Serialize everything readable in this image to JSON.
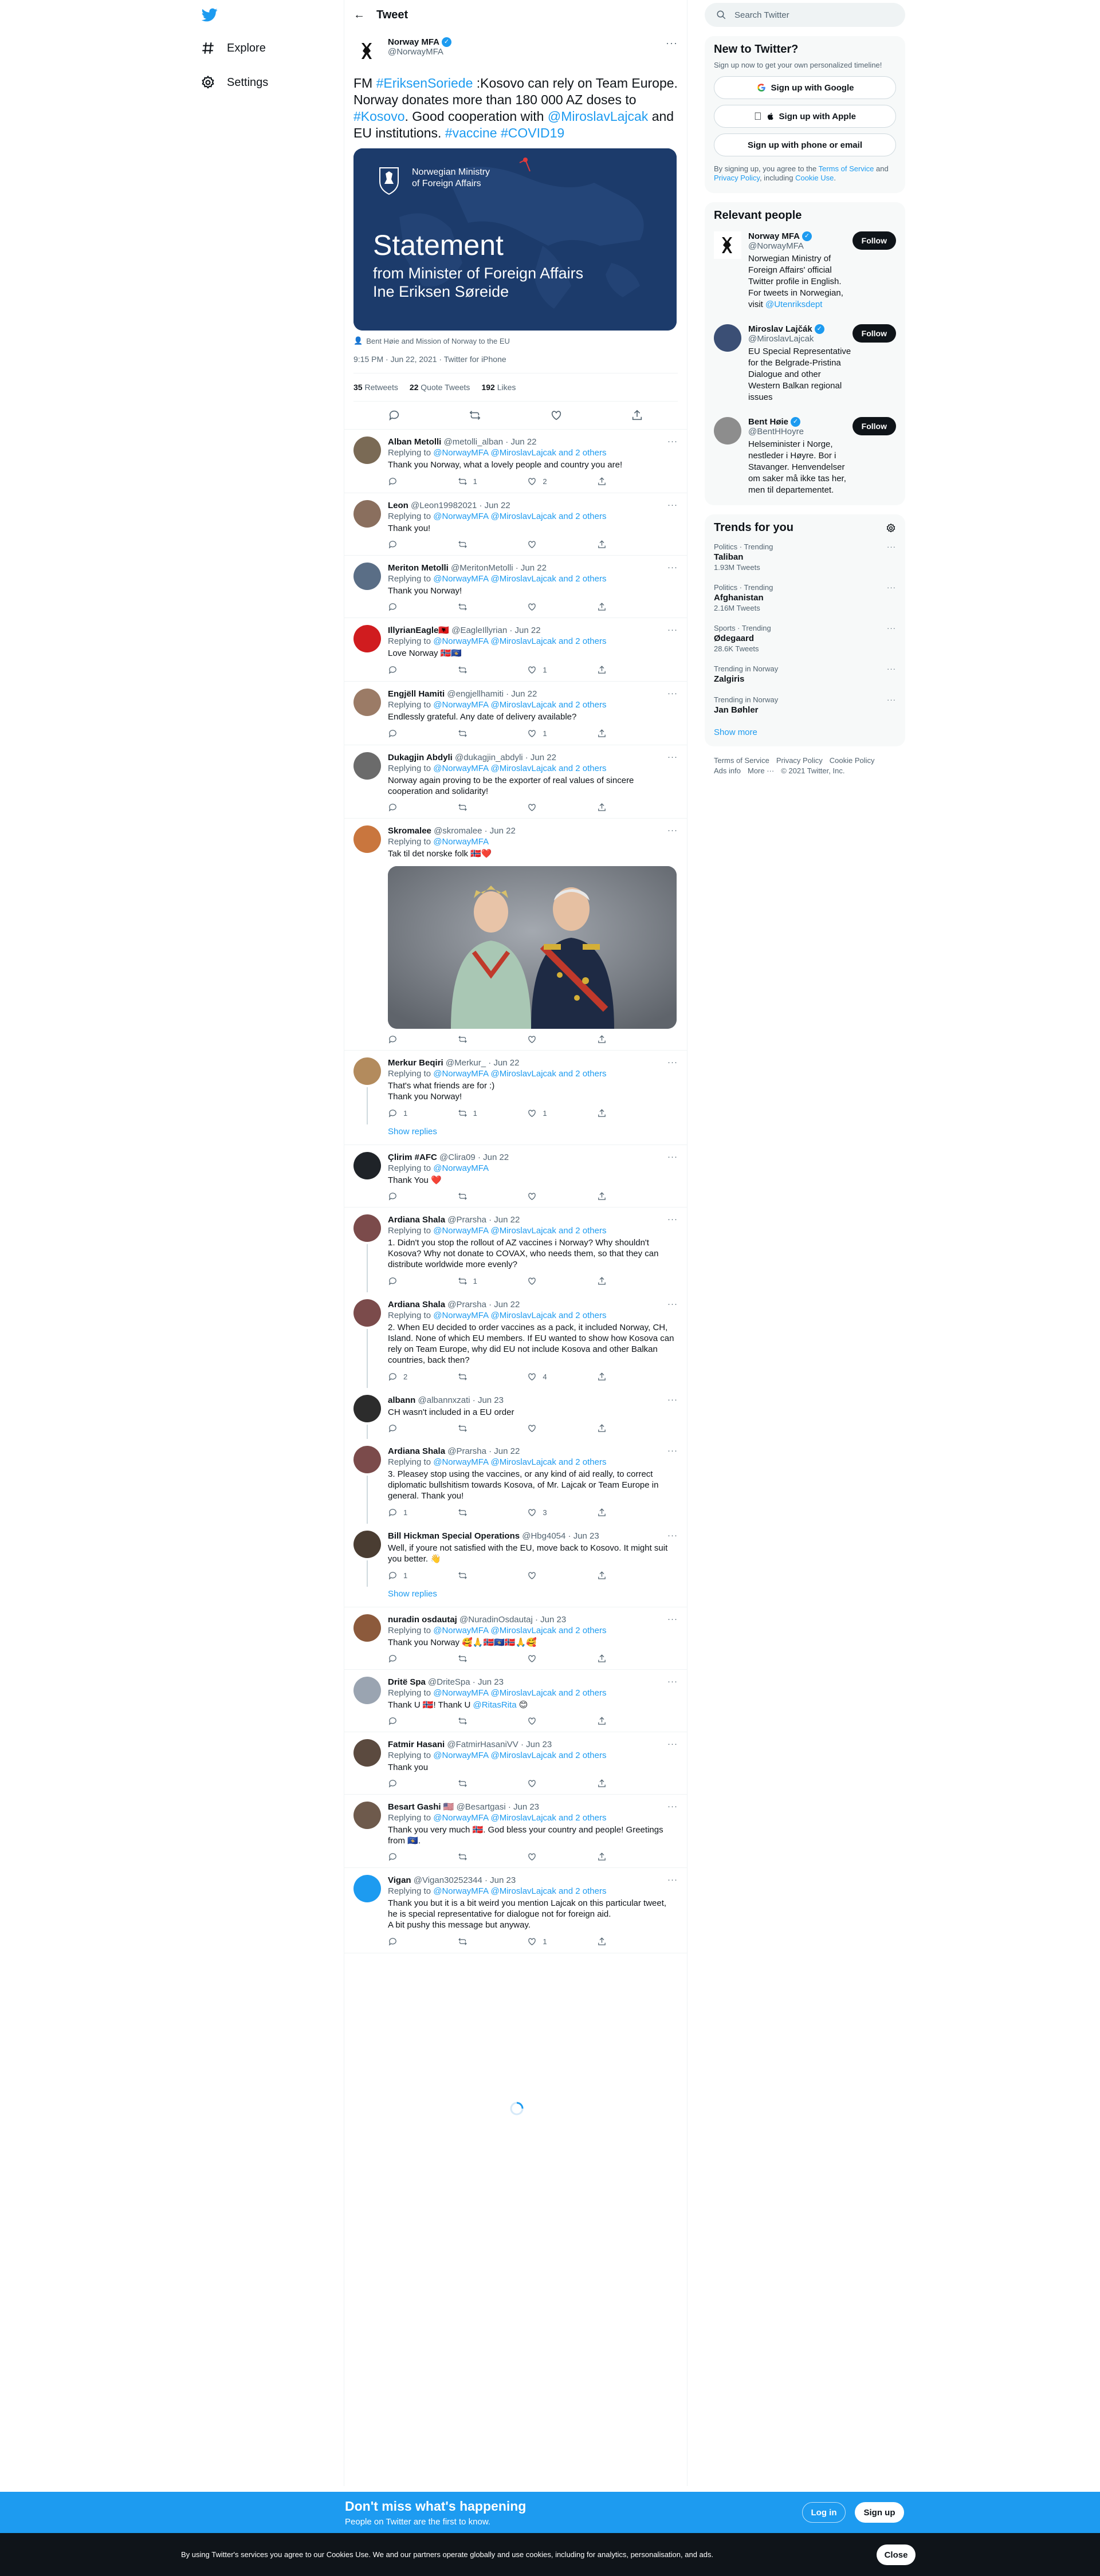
{
  "nav": {
    "explore": "Explore",
    "settings": "Settings"
  },
  "header": {
    "title": "Tweet"
  },
  "tweet": {
    "author": "Norway MFA",
    "handle": "@NorwayMFA",
    "text_parts": [
      {
        "t": "FM ",
        "link": false
      },
      {
        "t": "#EriksenSoriede",
        "link": true
      },
      {
        "t": " :Kosovo can rely on Team Europe. Norway donates more than 180 000 AZ doses to ",
        "link": false
      },
      {
        "t": "#Kosovo",
        "link": true
      },
      {
        "t": ". Good cooperation with ",
        "link": false
      },
      {
        "t": "@MiroslavLajcak",
        "link": true
      },
      {
        "t": " and EU institutions. ",
        "link": false
      },
      {
        "t": "#vaccine",
        "link": true
      },
      {
        "t": " ",
        "link": false
      },
      {
        "t": "#COVID19",
        "link": true
      }
    ],
    "card": {
      "ministry_line1": "Norwegian Ministry",
      "ministry_line2": "of Foreign Affairs",
      "statement": "Statement",
      "sub_line1": "from Minister of Foreign Affairs",
      "sub_line2": "Ine Eriksen Søreide"
    },
    "tagged": "Bent Høie and Mission of Norway to the EU",
    "meta": "9:15 PM · Jun 22, 2021 · Twitter for iPhone",
    "retweets": "35",
    "retweets_label": "Retweets",
    "quotes": "22",
    "quotes_label": "Quote Tweets",
    "likes": "192",
    "likes_label": "Likes"
  },
  "replies": [
    {
      "name": "Alban Metolli",
      "handle": "@metolli_alban · Jun 22",
      "replying": "@NorwayMFA @MiroslavLajcak and 2 others",
      "text": "Thank you Norway, what a lovely people and country you are!",
      "reply_count": "",
      "rt_count": "1",
      "like_count": "2",
      "avatar_color": "#7a6a55"
    },
    {
      "name": "Leon",
      "handle": "@Leon19982021 · Jun 22",
      "replying": "@NorwayMFA @MiroslavLajcak and 2 others",
      "text": "Thank you!",
      "reply_count": "",
      "rt_count": "",
      "like_count": "",
      "avatar_color": "#8a6f5e"
    },
    {
      "name": "Meriton Metolli",
      "handle": "@MeritonMetolli · Jun 22",
      "replying": "@NorwayMFA @MiroslavLajcak and 2 others",
      "text": "Thank you Norway!",
      "reply_count": "",
      "rt_count": "",
      "like_count": "",
      "avatar_color": "#5a6e86"
    },
    {
      "name": "IllyrianEagle🇦🇱",
      "handle": "@EagleIllyrian · Jun 22",
      "replying": "@NorwayMFA @MiroslavLajcak and 2 others",
      "text": "Love Norway 🇳🇴🇽🇰",
      "reply_count": "",
      "rt_count": "",
      "like_count": "1",
      "avatar_color": "#d01c1f"
    },
    {
      "name": "Engjëll Hamiti",
      "handle": "@engjellhamiti · Jun 22",
      "replying": "@NorwayMFA @MiroslavLajcak and 2 others",
      "text": "Endlessly grateful. Any date of delivery available?",
      "reply_count": "",
      "rt_count": "",
      "like_count": "1",
      "avatar_color": "#9b7b66"
    },
    {
      "name": "Dukagjin Abdyli",
      "handle": "@dukagjin_abdyli · Jun 22",
      "replying": "@NorwayMFA @MiroslavLajcak and 2 others",
      "text": "Norway again proving to be the exporter of real values of sincere cooperation and solidarity!",
      "reply_count": "",
      "rt_count": "",
      "like_count": "",
      "avatar_color": "#6b6b6b"
    },
    {
      "name": "Skromalee",
      "handle": "@skromalee · Jun 22",
      "replying": "@NorwayMFA",
      "text": "Tak til det norske folk 🇳🇴❤️",
      "reply_count": "",
      "rt_count": "",
      "like_count": "",
      "avatar_color": "#c9763e"
    },
    {
      "name": "Merkur Beqiri",
      "handle": "@Merkur_ · Jun 22",
      "replying": "@NorwayMFA @MiroslavLajcak and 2 others",
      "text": "That's what friends are for :)",
      "text2": "Thank you Norway!",
      "reply_count": "1",
      "rt_count": "1",
      "like_count": "1",
      "avatar_color": "#b38b5d"
    },
    {
      "name": "Çlirim #AFC",
      "handle": "@Clira09 · Jun 22",
      "replying": "@NorwayMFA",
      "text": "Thank You ❤️",
      "reply_count": "",
      "rt_count": "",
      "like_count": "",
      "avatar_color": "#1f2328"
    },
    {
      "name": "Ardiana Shala",
      "handle": "@Prarsha · Jun 22",
      "replying": "@NorwayMFA @MiroslavLajcak and 2 others",
      "text": "1. Didn't you stop the rollout of AZ vaccines i Norway? Why shouldn't Kosova? Why not donate to COVAX, who needs them, so that they can distribute worldwide more evenly?",
      "reply_count": "",
      "rt_count": "1",
      "like_count": "",
      "avatar_color": "#7b4b4b"
    },
    {
      "name": "Ardiana Shala",
      "handle": "@Prarsha · Jun 22",
      "replying": "@NorwayMFA @MiroslavLajcak and 2 others",
      "text": "2. When EU decided to order vaccines as a pack, it included Norway, CH, Island. None of which EU members. If EU wanted to show how Kosova can rely on Team Europe, why did EU not include Kosova and other Balkan countries, back then?",
      "reply_count": "2",
      "rt_count": "",
      "like_count": "4",
      "avatar_color": "#7b4b4b"
    },
    {
      "name": "albann",
      "handle": "@albannxzati · Jun 23",
      "replying": "",
      "text": "CH wasn't included in a EU order",
      "reply_count": "",
      "rt_count": "",
      "like_count": "",
      "avatar_color": "#2c2c2c"
    },
    {
      "name": "Ardiana Shala",
      "handle": "@Prarsha · Jun 22",
      "replying": "@NorwayMFA @MiroslavLajcak and 2 others",
      "text": "3. Pleasey stop using the vaccines, or any kind of aid really, to correct diplomatic bullshitism towards Kosova, of Mr. Lajcak or Team Europe in general. Thank you!",
      "reply_count": "1",
      "rt_count": "",
      "like_count": "3",
      "avatar_color": "#7b4b4b"
    },
    {
      "name": "Bill Hickman Special Operations",
      "handle": "@Hbg4054 · Jun 23",
      "replying": "",
      "text": "Well, if youre not satisfied with the EU, move back to Kosovo. It might suit you better. 👋",
      "reply_count": "1",
      "rt_count": "",
      "like_count": "",
      "avatar_color": "#4a3d32"
    },
    {
      "name": "nuradin osdautaj",
      "handle": "@NuradinOsdautaj · Jun 23",
      "replying": "@NorwayMFA @MiroslavLajcak and 2 others",
      "text": "Thank you Norway 🥰🙏🇳🇴🇽🇰🇳🇴🙏🥰",
      "reply_count": "",
      "rt_count": "",
      "like_count": "",
      "avatar_color": "#8c5a3c"
    },
    {
      "name": "Dritë Spa",
      "handle": "@DriteSpa · Jun 23",
      "replying": "@NorwayMFA @MiroslavLajcak and 2 others",
      "text_parts": [
        {
          "t": "Thank U 🇳🇴! Thank U ",
          "link": false
        },
        {
          "t": "@RitasRita",
          "link": true
        },
        {
          "t": " 😊",
          "link": false
        }
      ],
      "reply_count": "",
      "rt_count": "",
      "like_count": "",
      "avatar_color": "#9aa4b1"
    },
    {
      "name": "Fatmir Hasani",
      "handle": "@FatmirHasaniVV · Jun 23",
      "replying": "@NorwayMFA @MiroslavLajcak and 2 others",
      "text": "Thank you",
      "reply_count": "",
      "rt_count": "",
      "like_count": "",
      "avatar_color": "#5b4a3f"
    },
    {
      "name": "Besart Gashi 🇺🇸",
      "handle": "@Besartgasi · Jun 23",
      "replying": "@NorwayMFA @MiroslavLajcak and 2 others",
      "text": "Thank you very much 🇳🇴. God bless your country and people! Greetings from 🇽🇰.",
      "reply_count": "",
      "rt_count": "",
      "like_count": "",
      "avatar_color": "#6e5a4c"
    },
    {
      "name": "Vigan",
      "handle": "@Vigan30252344 · Jun 23",
      "replying": "@NorwayMFA @MiroslavLajcak and 2 others",
      "text": "Thank you but it is a bit weird you mention Lajcak on this particular tweet, he is special representative for dialogue not for foreign aid.",
      "text2": "A bit pushy this message but anyway.",
      "reply_count": "",
      "rt_count": "",
      "like_count": "1",
      "avatar_color": "#1d9bf0"
    }
  ],
  "replying_to_label": "Replying to",
  "show_replies": "Show replies",
  "sidebar": {
    "search_placeholder": "Search Twitter",
    "new_title": "New to Twitter?",
    "new_desc": "Sign up now to get your own personalized timeline!",
    "btn_google": "Sign up with Google",
    "btn_apple": "Sign up with Apple",
    "btn_phone": "Sign up with phone or email",
    "terms_pre": "By signing up, you agree to the ",
    "terms_tos": "Terms of Service",
    "terms_mid": " and ",
    "terms_pp": "Privacy Policy",
    "terms_mid2": ", including ",
    "terms_cookie": "Cookie Use",
    "terms_end": ".",
    "relevant_title": "Relevant people",
    "people": [
      {
        "name": "Norway MFA",
        "handle": "@NorwayMFA",
        "bio": "Norwegian Ministry of Foreign Affairs' official Twitter profile in English. For tweets in Norwegian, visit ",
        "bio_link": "@Utenriksdept",
        "follow": "Follow"
      },
      {
        "name": "Miroslav Lajčák",
        "handle": "@MiroslavLajcak",
        "bio": "EU Special Representative for the Belgrade-Pristina Dialogue and other Western Balkan regional issues",
        "bio_link": "",
        "follow": "Follow"
      },
      {
        "name": "Bent Høie",
        "handle": "@BentHHoyre",
        "bio": "Helseminister i Norge, nestleder i Høyre. Bor i Stavanger. Henvendelser om saker må ikke tas her, men til departementet.",
        "bio_link": "",
        "follow": "Follow"
      }
    ],
    "trends_title": "Trends for you",
    "trends": [
      {
        "ctx": "Politics · Trending",
        "name": "Taliban",
        "count": "1.93M Tweets"
      },
      {
        "ctx": "Politics · Trending",
        "name": "Afghanistan",
        "count": "2.16M Tweets"
      },
      {
        "ctx": "Sports · Trending",
        "name": "Ødegaard",
        "count": "28.6K Tweets"
      },
      {
        "ctx": "Trending in Norway",
        "name": "Zalgiris",
        "count": ""
      },
      {
        "ctx": "Trending in Norway",
        "name": "Jan Bøhler",
        "count": ""
      }
    ],
    "show_more": "Show more",
    "footer": [
      "Terms of Service",
      "Privacy Policy",
      "Cookie Policy",
      "Ads info",
      "More ···",
      "© 2021 Twitter, Inc."
    ]
  },
  "bottom": {
    "title": "Don't miss what's happening",
    "sub": "People on Twitter are the first to know.",
    "login": "Log in",
    "signup": "Sign up"
  },
  "cookie": {
    "text": "By using Twitter's services you agree to our Cookies Use. We and our partners operate globally and use cookies, including for analytics, personalisation, and ads.",
    "close": "Close"
  }
}
